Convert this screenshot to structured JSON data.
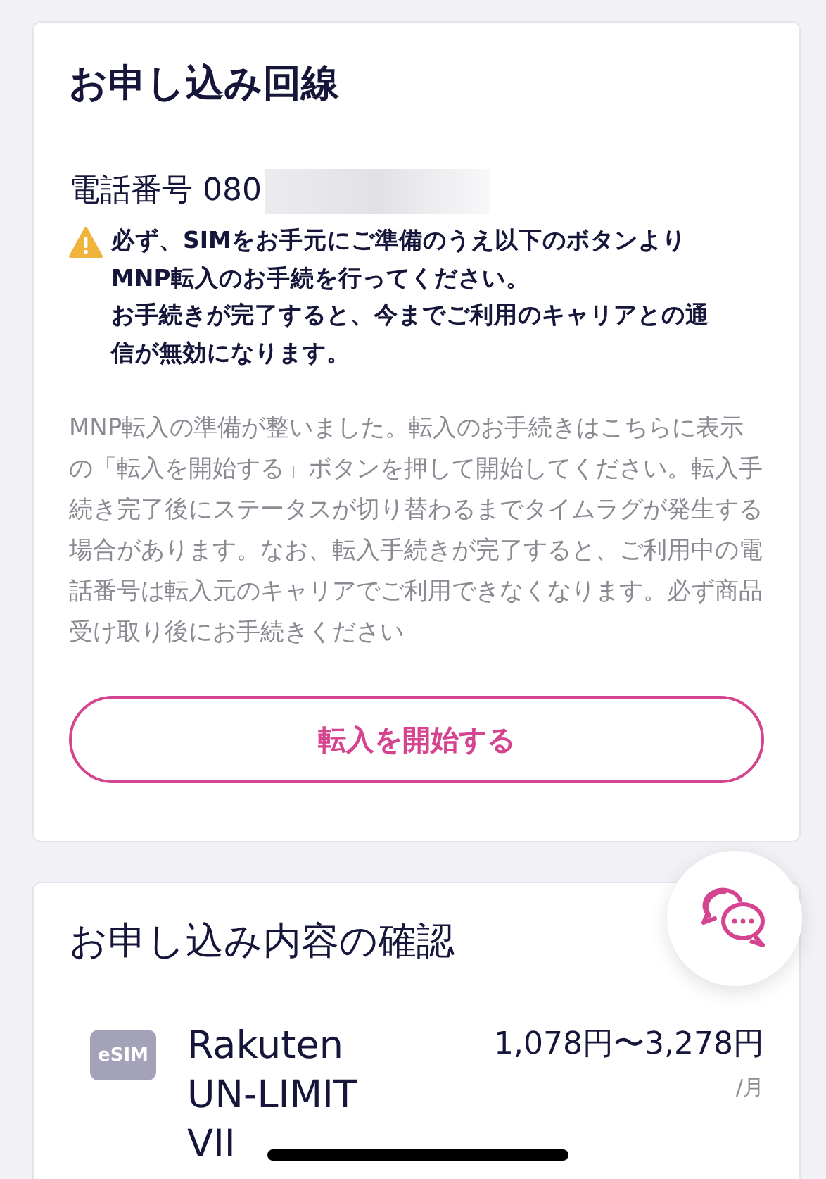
{
  "line_card": {
    "title": "お申し込み回線",
    "phone_label": "電話番号",
    "phone_number": "080",
    "warning": [
      "必ず、SIMをお手元にご準備のうえ以下のボタンよりMNP転入のお手続を行ってください。",
      "お手続きが完了すると、今までご利用のキャリアとの通信が無効になります。"
    ],
    "description": "MNP転入の準備が整いました。転入のお手続きはこちらに表示の「転入を開始する」ボタンを押して開始してください。転入手続き完了後にステータスが切り替わるまでタイムラグが発生する場合があります。なお、転入手続きが完了すると、ご利用中の電話番号は転入元のキャリアでご利用できなくなります。必ず商品受け取り後にお手続きください",
    "button": "転入を開始する"
  },
  "confirm_card": {
    "title": "お申し込み内容の確認",
    "plan": {
      "badge": "eSIM",
      "name": "Rakuten UN-LIMIT VII",
      "price": "1,078円〜3,278円",
      "unit": "/月"
    }
  }
}
